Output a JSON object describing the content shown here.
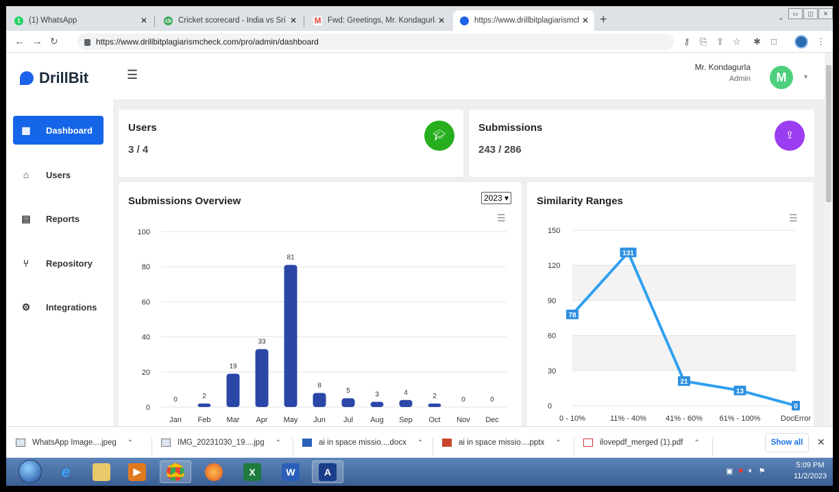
{
  "browser": {
    "tabs": [
      {
        "title": "(1) WhatsApp",
        "fav_color": "#25d366",
        "fav_text": "1"
      },
      {
        "title": "Cricket scorecard - India vs Sri La",
        "fav_color": "#3dab5a",
        "fav_text": "cb"
      },
      {
        "title": "Fwd: Greetings, Mr. Kondagurla! -",
        "fav_color": "#ea4335",
        "fav_text": "M"
      },
      {
        "title": "https://www.drillbitplagiarismche",
        "fav_color": "#1e62ea",
        "fav_text": ""
      }
    ],
    "new_tab": "+",
    "url": "https://www.drillbitplagiarismcheck.com/pro/admin/dashboard"
  },
  "app": {
    "logo_text": "DrillBit",
    "sidebar": [
      {
        "label": "Dashboard",
        "icon": "grid-icon",
        "glyph": "▦",
        "active": true
      },
      {
        "label": "Users",
        "icon": "presentation-icon",
        "glyph": "⌂",
        "active": false
      },
      {
        "label": "Reports",
        "icon": "report-icon",
        "glyph": "▤",
        "active": false
      },
      {
        "label": "Repository",
        "icon": "branch-icon",
        "glyph": "⑂",
        "active": false
      },
      {
        "label": "Integrations",
        "icon": "gear-icon",
        "glyph": "⚙",
        "active": false
      }
    ],
    "user": {
      "name": "Mr. Kondagurla",
      "role": "Admin",
      "avatar_letter": "M",
      "avatar_color": "#4cd07d"
    },
    "cards": {
      "users": {
        "title": "Users",
        "value": "3 / 4",
        "icon_color": "#27ae1f"
      },
      "submissions": {
        "title": "Submissions",
        "value": "243 / 286",
        "icon_color": "#9b3df0"
      }
    },
    "submissions_chart": {
      "title": "Submissions Overview",
      "year": "2023"
    },
    "similarity_chart": {
      "title": "Similarity Ranges"
    }
  },
  "chart_data": [
    {
      "type": "bar",
      "title": "Submissions Overview",
      "categories": [
        "Jan",
        "Feb",
        "Mar",
        "Apr",
        "May",
        "Jun",
        "Jul",
        "Aug",
        "Sep",
        "Oct",
        "Nov",
        "Dec"
      ],
      "values": [
        0,
        2,
        19,
        33,
        81,
        8,
        5,
        3,
        4,
        2,
        0,
        0
      ],
      "yticks": [
        0,
        20,
        40,
        60,
        80,
        100
      ],
      "ylim": [
        0,
        100
      ],
      "color": "#2a47a8",
      "grid": true
    },
    {
      "type": "line",
      "title": "Similarity Ranges",
      "categories": [
        "0 - 10%",
        "11% - 40%",
        "41% - 60%",
        "61% - 100%",
        "DocError"
      ],
      "values": [
        78,
        131,
        21,
        13,
        0
      ],
      "yticks": [
        0,
        30,
        60,
        90,
        120,
        150
      ],
      "ylim": [
        0,
        150
      ],
      "color": "#2f9ff0",
      "grid": true
    }
  ],
  "downloads": [
    {
      "name": "WhatsApp Image....jpeg"
    },
    {
      "name": "IMG_20231030_19....jpg"
    },
    {
      "name": "ai in space missio....docx"
    },
    {
      "name": "ai in space missio....pptx"
    },
    {
      "name": "ilovepdf_merged (1).pdf"
    }
  ],
  "downloads_show_all": "Show all",
  "taskbar": {
    "time": "5:09 PM",
    "date": "11/2/2023"
  }
}
